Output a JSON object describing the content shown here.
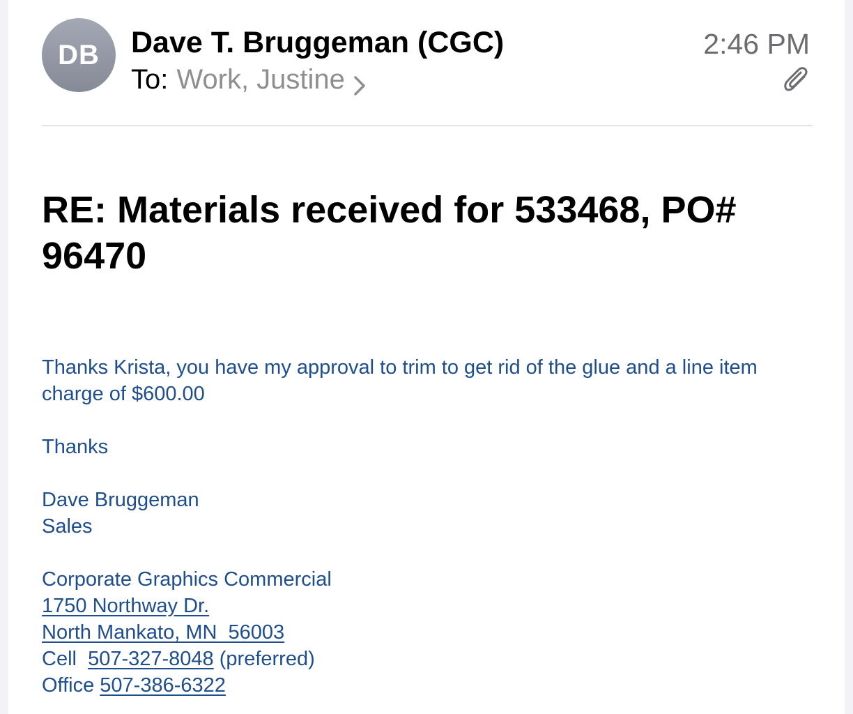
{
  "header": {
    "avatar_initials": "DB",
    "sender_name": "Dave T. Bruggeman (CGC)",
    "to_label": "To:",
    "to_recipient": "Work, Justine",
    "time": "2:46 PM",
    "icons": {
      "chevron": "chevron-right-icon",
      "attachment": "paperclip-icon"
    }
  },
  "subject": "RE: Materials received for 533468, PO# 96470",
  "body": {
    "line1": "Thanks Krista, you have my approval to trim to get rid of the glue and a line item charge of $600.00",
    "thanks": "Thanks",
    "signature_name": "Dave Bruggeman",
    "signature_title": "Sales",
    "company": "Corporate Graphics Commercial",
    "address_line1": "1750 Northway Dr.",
    "address_line2": "North Mankato, MN  56003",
    "cell_label": "Cell ",
    "cell_number": "507-327-8048",
    "cell_note": " (preferred)",
    "office_label": "Office ",
    "office_number": "507-386-6322"
  },
  "colors": {
    "body_text": "#1f4e8c",
    "secondary_text": "#8e8e93",
    "avatar_bg": "#8e929e"
  }
}
